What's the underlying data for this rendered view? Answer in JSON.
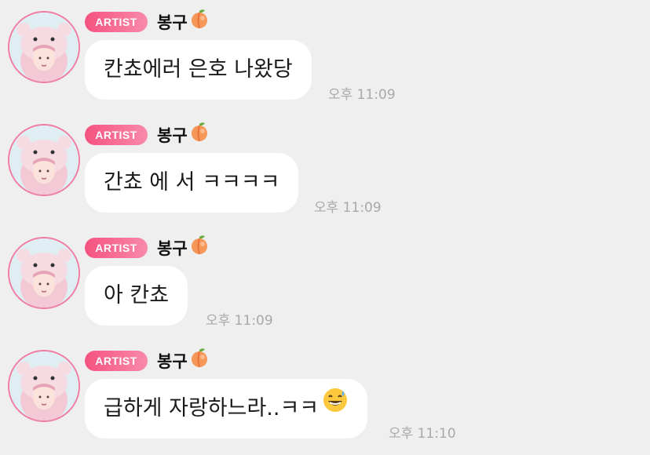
{
  "colors": {
    "background": "#efefef",
    "bubble": "#ffffff",
    "badge_start": "#f5527f",
    "badge_end": "#f98aab",
    "avatar_ring": "#f07aa3",
    "timestamp": "#a9a9a9"
  },
  "messages": [
    {
      "badge": "ARTIST",
      "sender": "봉구",
      "sender_emoji": "peach-icon",
      "text": "칸쵸에러 은호 나왔당",
      "time": "오후 11:09"
    },
    {
      "badge": "ARTIST",
      "sender": "봉구",
      "sender_emoji": "peach-icon",
      "text": "간쵸 에 서 ㅋㅋㅋㅋ",
      "time": "오후 11:09"
    },
    {
      "badge": "ARTIST",
      "sender": "봉구",
      "sender_emoji": "peach-icon",
      "text": "아 칸쵸",
      "time": "오후 11:09"
    },
    {
      "badge": "ARTIST",
      "sender": "봉구",
      "sender_emoji": "peach-icon",
      "text": "급하게 자랑하느라..ㅋㅋ",
      "text_emoji": "grinning-sweat-icon",
      "time": "오후 11:10"
    }
  ]
}
